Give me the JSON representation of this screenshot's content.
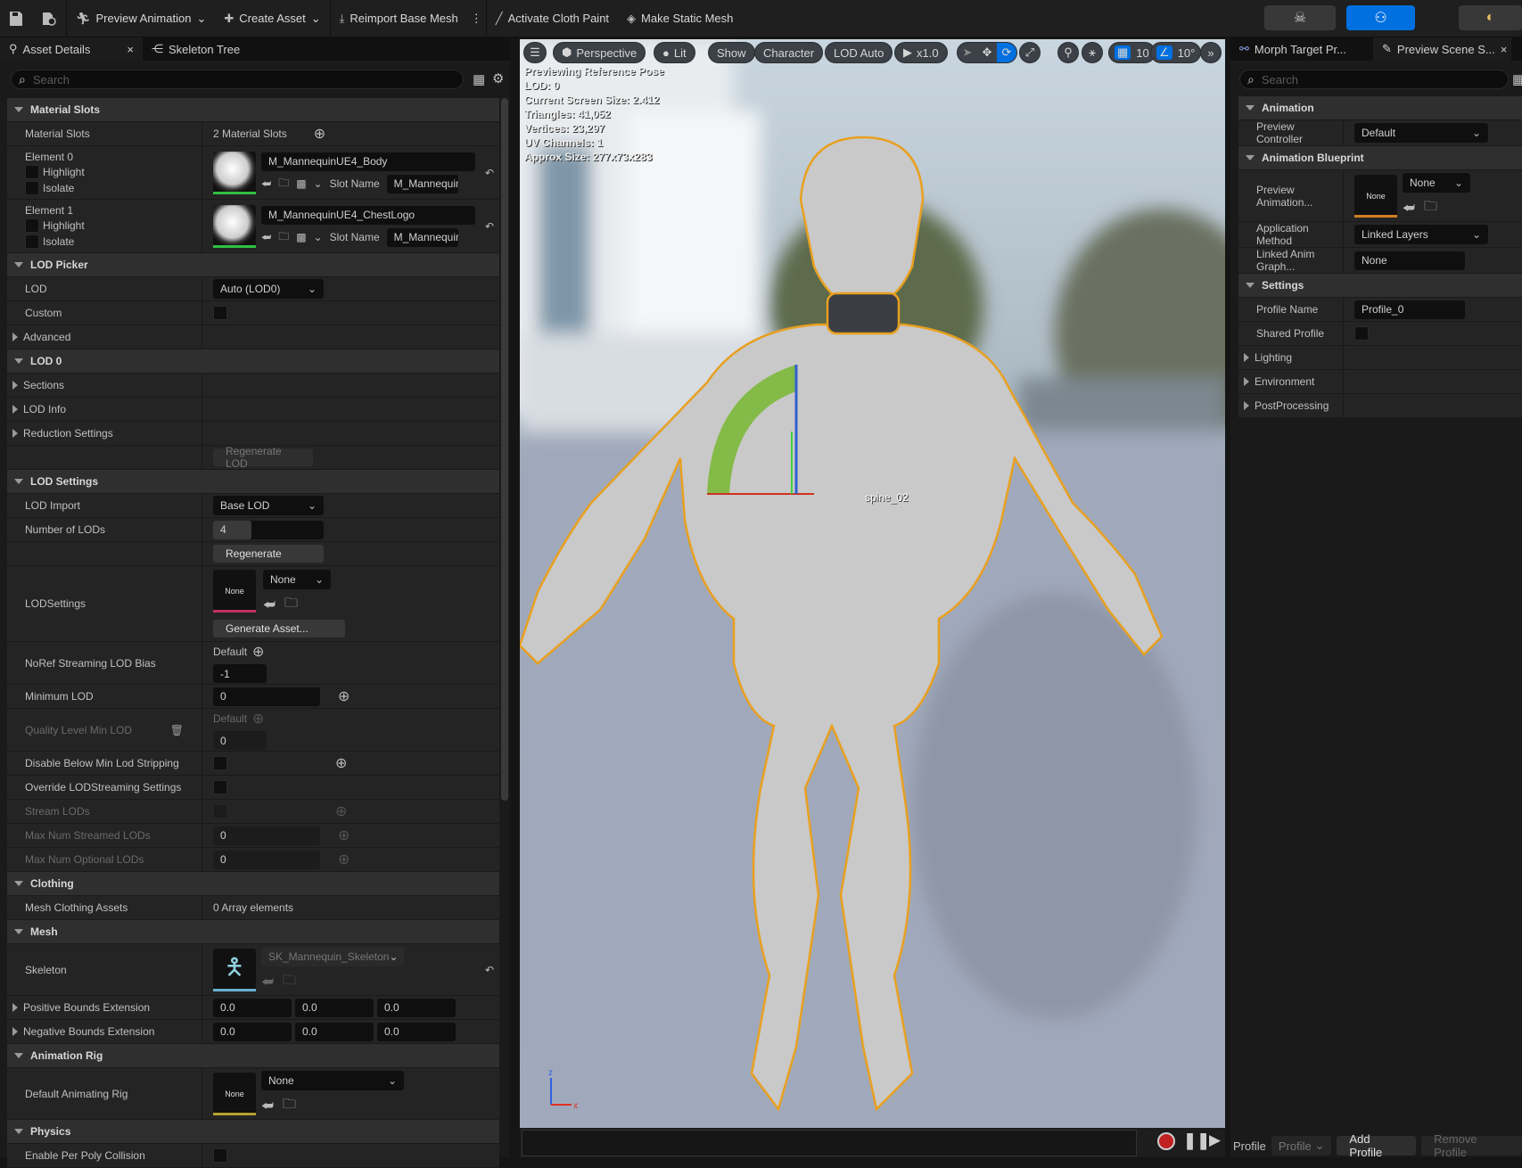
{
  "toolbar": {
    "preview_animation": "Preview Animation",
    "create_asset": "Create Asset",
    "reimport": "Reimport Base Mesh",
    "cloth_paint": "Activate Cloth Paint",
    "make_static": "Make Static Mesh"
  },
  "left_tabs": {
    "asset_details": "Asset Details",
    "skeleton_tree": "Skeleton Tree",
    "search_placeholder": "Search"
  },
  "left_rows": [
    {
      "t": "hdr",
      "label": "Material Slots"
    },
    {
      "t": "prop",
      "label": "Material Slots",
      "w": "text_add",
      "value": "2 Material Slots"
    },
    {
      "t": "material",
      "label": "Element 0",
      "highlight": "Highlight",
      "isolate": "Isolate",
      "material": "M_MannequinUE4_Body",
      "slot_label": "Slot Name",
      "slot": "M_Mannequin"
    },
    {
      "t": "material",
      "label": "Element 1",
      "highlight": "Highlight",
      "isolate": "Isolate",
      "material": "M_MannequinUE4_ChestLogo",
      "slot_label": "Slot Name",
      "slot": "M_Mannequin"
    },
    {
      "t": "hdr",
      "label": "LOD Picker"
    },
    {
      "t": "prop",
      "label": "LOD",
      "w": "dropdown",
      "value": "Auto (LOD0)"
    },
    {
      "t": "prop",
      "label": "Custom",
      "w": "checkbox"
    },
    {
      "t": "prop",
      "label": "Advanced",
      "exp": true
    },
    {
      "t": "hdr",
      "label": "LOD 0"
    },
    {
      "t": "prop",
      "label": "Sections",
      "exp": true
    },
    {
      "t": "prop",
      "label": "LOD Info",
      "exp": true
    },
    {
      "t": "prop",
      "label": "Reduction Settings",
      "exp": true
    },
    {
      "t": "prop",
      "label": "",
      "w": "button_dim",
      "value": "Regenerate LOD"
    },
    {
      "t": "hdr",
      "label": "LOD Settings"
    },
    {
      "t": "prop",
      "label": "LOD Import",
      "w": "dropdown",
      "value": "Base LOD"
    },
    {
      "t": "prop",
      "label": "Number of LODs",
      "w": "slider",
      "value": "4",
      "fraction": 0.35
    },
    {
      "t": "prop",
      "label": "",
      "w": "button",
      "value": "Regenerate"
    },
    {
      "t": "prop",
      "label": "LODSettings",
      "w": "asset_gen",
      "thumb": "None",
      "value": "None",
      "button": "Generate Asset..."
    },
    {
      "t": "prop",
      "label": "NoRef Streaming LOD Bias",
      "w": "default_input",
      "default": "Default",
      "value": "-1"
    },
    {
      "t": "prop",
      "label": "Minimum LOD",
      "w": "input_add",
      "value": "0"
    },
    {
      "t": "prop",
      "label": "Quality Level Min LOD",
      "w": "default_input",
      "default": "Default",
      "value": "0",
      "disabled": true,
      "trash": true
    },
    {
      "t": "prop",
      "label": "Disable Below Min Lod Stripping",
      "w": "checkbox_add"
    },
    {
      "t": "prop",
      "label": "Override LODStreaming Settings",
      "w": "checkbox"
    },
    {
      "t": "prop",
      "label": "Stream LODs",
      "w": "checkbox_add",
      "disabled": true
    },
    {
      "t": "prop",
      "label": "Max Num Streamed LODs",
      "w": "input_add",
      "value": "0",
      "disabled": true
    },
    {
      "t": "prop",
      "label": "Max Num Optional LODs",
      "w": "input_add",
      "value": "0",
      "disabled": true
    },
    {
      "t": "hdr",
      "label": "Clothing"
    },
    {
      "t": "prop",
      "label": "Mesh Clothing Assets",
      "w": "text",
      "value": "0 Array elements"
    },
    {
      "t": "hdr",
      "label": "Mesh"
    },
    {
      "t": "prop",
      "label": "Skeleton",
      "w": "asset",
      "thumb": "",
      "value": "SK_Mannequin_Skeleton",
      "underline": "#6ab0d0",
      "dimdd": true,
      "reset": true
    },
    {
      "t": "prop",
      "label": "Positive Bounds Extension",
      "exp": true,
      "w": "vec3",
      "values": [
        "0.0",
        "0.0",
        "0.0"
      ]
    },
    {
      "t": "prop",
      "label": "Negative Bounds Extension",
      "exp": true,
      "w": "vec3",
      "values": [
        "0.0",
        "0.0",
        "0.0"
      ]
    },
    {
      "t": "hdr",
      "label": "Animation Rig"
    },
    {
      "t": "prop",
      "label": "Default Animating Rig",
      "w": "asset",
      "thumb": "None",
      "value": "None",
      "underline": "#b8a030"
    },
    {
      "t": "hdr",
      "label": "Physics"
    },
    {
      "t": "prop",
      "label": "Enable Per Poly Collision",
      "w": "checkbox"
    }
  ],
  "viewport": {
    "toolbar": {
      "perspective": "Perspective",
      "lit": "Lit",
      "show": "Show",
      "character": "Character",
      "lod": "LOD Auto",
      "speed": "x1.0",
      "grid": "10",
      "angle": "10°"
    },
    "stats": [
      "Previewing Reference Pose",
      "LOD: 0",
      "Current Screen Size: 2.412",
      "Triangles: 41,052",
      "Vertices: 23,297",
      "UV Channels: 1",
      "Approx Size: 277x73x283"
    ],
    "bone_label": "spine_02"
  },
  "right_tabs": {
    "morph": "Morph Target Pr...",
    "preview_scene": "Preview Scene S...",
    "search_placeholder": "Search"
  },
  "right_rows": [
    {
      "t": "hdr",
      "label": "Animation"
    },
    {
      "t": "prop",
      "label": "Preview Controller",
      "w": "dropdown",
      "value": "Default"
    },
    {
      "t": "hdr",
      "label": "Animation Blueprint"
    },
    {
      "t": "prop",
      "label": "Preview Animation...",
      "w": "asset",
      "thumb": "None",
      "value": "None",
      "underline": "#d08020"
    },
    {
      "t": "prop",
      "label": "Application Method",
      "w": "dropdown",
      "value": "Linked Layers"
    },
    {
      "t": "prop",
      "label": "Linked Anim Graph...",
      "w": "inputw",
      "value": "None"
    },
    {
      "t": "hdr",
      "label": "Settings"
    },
    {
      "t": "prop",
      "label": "Profile Name",
      "w": "inputw",
      "value": "Profile_0"
    },
    {
      "t": "prop",
      "label": "Shared Profile",
      "w": "checkbox"
    },
    {
      "t": "prop",
      "label": "Lighting",
      "exp": true
    },
    {
      "t": "prop",
      "label": "Environment",
      "exp": true
    },
    {
      "t": "prop",
      "label": "PostProcessing",
      "exp": true
    }
  ],
  "profile_bar": {
    "label": "Profile",
    "dropdown": "Profile",
    "add": "Add Profile",
    "remove": "Remove Profile"
  },
  "colors": {
    "accent": "#0070e0",
    "selection_outline": "#e8a020"
  }
}
